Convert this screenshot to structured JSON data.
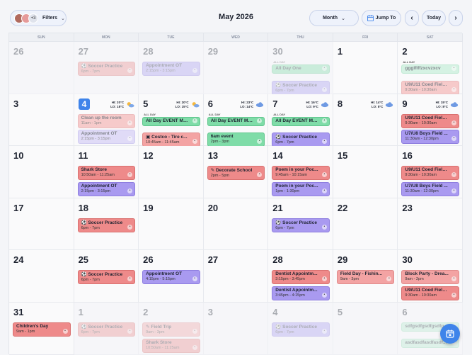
{
  "header": {
    "filters_label": "Filters",
    "filters_extra": "+3",
    "title": "May 2026",
    "view_label": "Month",
    "jump_label": "Jump To",
    "prev_label": "‹",
    "next_label": "›",
    "today_label": "Today"
  },
  "weekdays": [
    "SUN",
    "MON",
    "TUE",
    "WED",
    "THU",
    "FRI",
    "SAT"
  ],
  "all_day_label": "ALL DAY",
  "weeks": [
    [
      {
        "day": "26",
        "out": true,
        "events": []
      },
      {
        "day": "27",
        "out": true,
        "events": [
          {
            "title": "Soccer Practice",
            "time": "6pm - 7pm",
            "color": "red",
            "icon": "ball-icon"
          }
        ]
      },
      {
        "day": "28",
        "out": true,
        "events": [
          {
            "title": "Appointment OT",
            "time": "2:15pm - 3:15pm",
            "color": "purple"
          }
        ]
      },
      {
        "day": "29",
        "out": true,
        "events": []
      },
      {
        "day": "30",
        "out": true,
        "allday": true,
        "events": [
          {
            "title": "All Day One",
            "time": "",
            "color": "green"
          },
          {
            "title": "Soccer Practice",
            "time": "6pm - 7pm",
            "color": "purple",
            "icon": "ball-icon"
          }
        ]
      },
      {
        "day": "1",
        "events": []
      },
      {
        "day": "2",
        "allday": true,
        "events": [
          {
            "title": "ggglflffzxcvzxcv",
            "time": "",
            "color": "mint",
            "faded": true
          },
          {
            "title": "U9/U11 Coed Field...",
            "time": "9:30am - 10:30am",
            "color": "salmon",
            "faded": true
          }
        ]
      }
    ],
    [
      {
        "day": "3",
        "events": []
      },
      {
        "day": "4",
        "today": true,
        "weather": {
          "hi": "HI: 20°C",
          "lo": "LO: 18°C",
          "kind": "sun"
        },
        "events": [
          {
            "title": "Clean up the room",
            "time": "11am - 1pm",
            "color": "salmon",
            "faded": true
          },
          {
            "title": "Appointment OT",
            "time": "2:15pm - 3:15pm",
            "color": "lav",
            "faded": true
          }
        ]
      },
      {
        "day": "5",
        "allday": true,
        "weather": {
          "hi": "HI: 20°C",
          "lo": "LO: 15°C",
          "kind": "sun"
        },
        "events": [
          {
            "title": "All Day EVENT MU...",
            "time": "",
            "color": "green"
          },
          {
            "title": "Costco - Tire c...",
            "time": "10:45am - 11:45am",
            "color": "salmon",
            "icon": "store-icon"
          }
        ]
      },
      {
        "day": "6",
        "allday": true,
        "weather": {
          "hi": "HI: 23°C",
          "lo": "LO: 14°C",
          "kind": "cloud"
        },
        "events": [
          {
            "title": "All Day EVENT MU...",
            "time": "",
            "color": "green"
          },
          {
            "title": "6am event",
            "time": "2pm - 3pm",
            "color": "green"
          }
        ]
      },
      {
        "day": "7",
        "allday": true,
        "weather": {
          "hi": "HI: 16°C",
          "lo": "LO: 9°C",
          "kind": "cloud"
        },
        "events": [
          {
            "title": "All Day EVENT MU...",
            "time": "",
            "color": "green"
          },
          {
            "title": "Soccer Practice",
            "time": "6pm - 7pm",
            "color": "purple",
            "icon": "ball-icon"
          }
        ]
      },
      {
        "day": "8",
        "weather": {
          "hi": "HI: 14°C",
          "lo": "LO: 8°C",
          "kind": "cloud"
        },
        "events": []
      },
      {
        "day": "9",
        "weather": {
          "hi": "HI: 15°C",
          "lo": "LO: 8°C",
          "kind": "cloud"
        },
        "events": [
          {
            "title": "U9/U11 Coed Field...",
            "time": "9:30am - 10:30am",
            "color": "red"
          },
          {
            "title": "U7/U8 Boys Field ...",
            "time": "11:30am - 12:30pm",
            "color": "purple"
          }
        ]
      }
    ],
    [
      {
        "day": "10",
        "events": []
      },
      {
        "day": "11",
        "events": [
          {
            "title": "Shark Store",
            "time": "10:50am - 11:25am",
            "color": "red"
          },
          {
            "title": "Appointment OT",
            "time": "2:15pm - 3:15pm",
            "color": "purple"
          }
        ]
      },
      {
        "day": "12",
        "events": []
      },
      {
        "day": "13",
        "events": [
          {
            "title": "Decorate School",
            "time": "2pm - 5pm",
            "color": "red",
            "icon": "brush-icon"
          }
        ]
      },
      {
        "day": "14",
        "events": [
          {
            "title": "Poem in your Poc...",
            "time": "9:45am - 10:15am",
            "color": "red"
          },
          {
            "title": "Poem in your Poc...",
            "time": "1pm - 1:30pm",
            "color": "purple"
          }
        ]
      },
      {
        "day": "15",
        "events": []
      },
      {
        "day": "16",
        "events": [
          {
            "title": "U9/U11 Coed Field...",
            "time": "9:30am - 10:30am",
            "color": "red"
          },
          {
            "title": "U7/U8 Boys Field ...",
            "time": "11:30am - 12:30pm",
            "color": "purple"
          }
        ]
      }
    ],
    [
      {
        "day": "17",
        "events": []
      },
      {
        "day": "18",
        "events": [
          {
            "title": "Soccer Practice",
            "time": "6pm - 7pm",
            "color": "red",
            "icon": "ball-icon"
          }
        ]
      },
      {
        "day": "19",
        "events": []
      },
      {
        "day": "20",
        "events": []
      },
      {
        "day": "21",
        "events": [
          {
            "title": "Soccer Practice",
            "time": "6pm - 7pm",
            "color": "purple",
            "icon": "ball-icon"
          }
        ]
      },
      {
        "day": "22",
        "events": []
      },
      {
        "day": "23",
        "events": []
      }
    ],
    [
      {
        "day": "24",
        "events": []
      },
      {
        "day": "25",
        "events": [
          {
            "title": "Soccer Practice",
            "time": "6pm - 7pm",
            "color": "red",
            "icon": "ball-icon"
          }
        ]
      },
      {
        "day": "26",
        "events": [
          {
            "title": "Appointment OT",
            "time": "4:15pm - 5:15pm",
            "color": "purple"
          }
        ]
      },
      {
        "day": "27",
        "events": []
      },
      {
        "day": "28",
        "events": [
          {
            "title": "Dentist Appointm...",
            "time": "3:15pm - 3:45pm",
            "color": "red"
          },
          {
            "title": "Dentist Appointm...",
            "time": "3:45pm - 4:15pm",
            "color": "purple"
          }
        ]
      },
      {
        "day": "29",
        "events": [
          {
            "title": "Field Day - Fishin...",
            "time": "9am - 3pm",
            "color": "salmon"
          }
        ]
      },
      {
        "day": "30",
        "events": [
          {
            "title": "Block Party - Drea...",
            "time": "9am - 2pm",
            "color": "salmon"
          },
          {
            "title": "U9/U11 Coed Field...",
            "time": "9:30am - 10:30am",
            "color": "red"
          }
        ]
      }
    ],
    [
      {
        "day": "31",
        "events": [
          {
            "title": "Children's Day",
            "time": "9am - 1pm",
            "color": "red"
          }
        ]
      },
      {
        "day": "1",
        "out": true,
        "events": [
          {
            "title": "Soccer Practice",
            "time": "6pm - 7pm",
            "color": "red",
            "icon": "ball-icon"
          }
        ]
      },
      {
        "day": "2",
        "out": true,
        "events": [
          {
            "title": "Field Trip",
            "time": "9am - 3pm",
            "color": "salmon",
            "icon": "brush-icon"
          },
          {
            "title": "Shark Store",
            "time": "10:50am - 11:25am",
            "color": "red"
          }
        ]
      },
      {
        "day": "3",
        "out": true,
        "events": []
      },
      {
        "day": "4",
        "out": true,
        "events": [
          {
            "title": "Soccer Practice",
            "time": "6pm - 7pm",
            "color": "purple",
            "icon": "ball-icon"
          }
        ]
      },
      {
        "day": "5",
        "out": true,
        "events": []
      },
      {
        "day": "6",
        "out": true,
        "events": [
          {
            "title": "sdfgsdfgsdfgsdfg...",
            "time": "",
            "color": "mint"
          },
          {
            "title": "asdfasdfasdfasdf...",
            "time": "",
            "color": "mint"
          }
        ]
      }
    ]
  ],
  "colors": {
    "accent": "#3f84ea",
    "red": "#ee8a8a",
    "green": "#7fdca8",
    "purple": "#a99af0"
  }
}
